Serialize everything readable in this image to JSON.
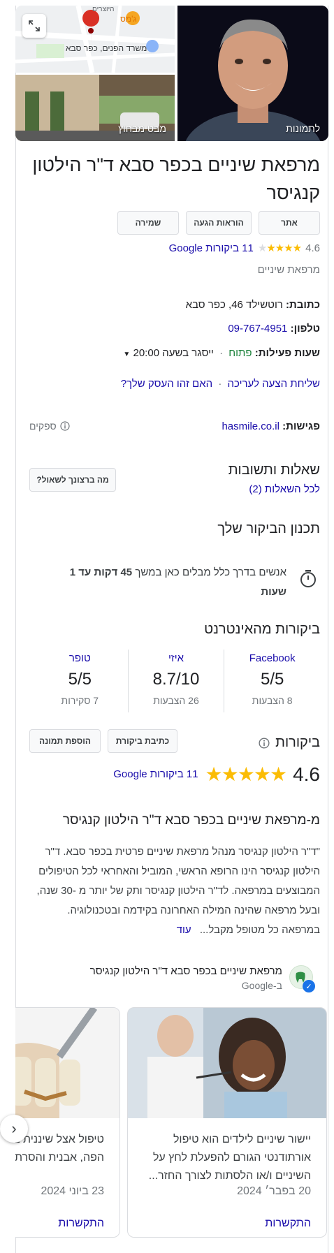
{
  "photos": {
    "main_caption": "לתמונות",
    "street_caption": "מבט מבחוץ",
    "map_labels": [
      "ג'מס",
      "משרד הפנים, כפר סבא",
      "היוצרים"
    ]
  },
  "business": {
    "title": "מרפאת שיניים בכפר סבא ד\"ר הילטון קנגיסר",
    "rating": "4.6",
    "reviews_link": "11 ביקורות Google",
    "category": "מרפאת שיניים"
  },
  "actions": {
    "website": "אתר",
    "directions": "הוראות הגעה",
    "save": "שמירה"
  },
  "info": {
    "address_label": "כתובת:",
    "address": "רוטשילד 46, כפר סבא",
    "phone_label": "טלפון:",
    "phone": "09-767-4951",
    "hours_label": "שעות פעילות:",
    "hours_open": "פתוח",
    "hours_close": "ייסגר בשעה 20:00",
    "suggest_edit": "שליחת הצעה לעריכה",
    "own_business": "האם זהו העסק שלך?",
    "appointments_label": "פגישות:",
    "appointments_link": "hasmile.co.il",
    "providers": "ספקים"
  },
  "qa": {
    "title": "שאלות ותשובות",
    "all_questions": "לכל השאלות (2)",
    "ask_button": "מה ברצונך לשאול?"
  },
  "visit": {
    "title": "תכנון הביקור שלך",
    "text_pre": "אנשים בדרך כלל מבלים כאן במשך ",
    "text_bold": "45 דקות עד 1 שעות"
  },
  "web_reviews": {
    "title": "ביקורות מהאינטרנט",
    "sources": [
      {
        "name": "Facebook",
        "score": "5/5",
        "count": "8 הצבעות"
      },
      {
        "name": "איזי",
        "score": "8.7/10",
        "count": "26 הצבעות"
      },
      {
        "name": "טופר",
        "score": "5/5",
        "count": "7 סקירות"
      }
    ]
  },
  "reviews": {
    "title": "ביקורות",
    "write": "כתיבת ביקורת",
    "add_photo": "הוספת תמונה",
    "rating": "4.6",
    "google_link": "11 ביקורות Google"
  },
  "from_business": {
    "title": "מ-מרפאת שיניים בכפר סבא ד\"ר הילטון קנגיסר",
    "description": "\"ד\"ר הילטון קנגיסר מנהל מרפאת שיניים פרטית בכפר סבא. ד\"ר הילטון קנגיסר הינו הרופא הראשי, המוביל והאחראי לכל הטיפולים המבוצעים במרפאה. לד\"ר הילטון קנגיסר ותק של יותר מ -30 שנה, ובעל מרפאה שהינה המילה האחרונה בקידמה ובטכנולוגיה. במרפאה כל מטופל מקבל...",
    "more": "עוד"
  },
  "posts": {
    "business_name": "מרפאת שיניים בכפר סבא ד\"ר הילטון קנגיסר",
    "source": "ב-Google",
    "items": [
      {
        "text": "יישור שיניים לילדים הוא טיפול אורתודנטי הגורם להפעלת לחץ על השיניים ו/או הלסתות לצורך החזר...",
        "date": "20 בפבר׳ 2024",
        "link": "התקשרות"
      },
      {
        "text": "טיפול אצל שיננית בשמירת היגיינת הפה, אבנית והסרת פלאק",
        "date": "23 ביוני 2024",
        "link": "התקשרות"
      }
    ]
  }
}
